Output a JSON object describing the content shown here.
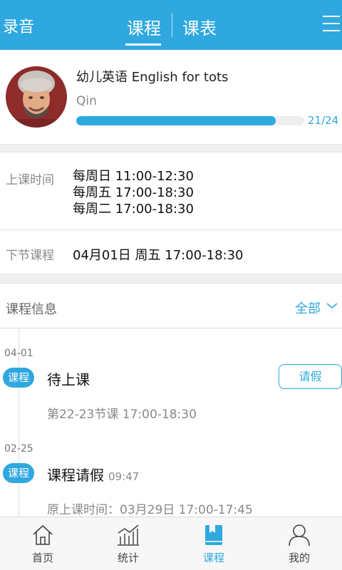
{
  "colors": {
    "accent": "#2fa8e0",
    "muted": "#888888",
    "divider": "#e4e4e4"
  },
  "header": {
    "left_label": "录音",
    "tabs": [
      {
        "label": "课程",
        "active": true
      },
      {
        "label": "课表",
        "active": false
      }
    ],
    "menu_icon": "hamburger-menu-icon"
  },
  "profile": {
    "course_title": "幼儿英语 English for tots",
    "teacher": "Qin",
    "progress_text": "21/24",
    "progress_fraction": 0.875
  },
  "schedule": {
    "class_time_label": "上课时间",
    "class_times": [
      "每周日 11:00-12:30",
      "每周五 17:00-18:30",
      "每周二 17:00-18:30"
    ],
    "next_label": "下节课程",
    "next_value": "04月01日 周五 17:00-18:30"
  },
  "info": {
    "title": "课程信息",
    "filter": "全部",
    "filter_icon": "chevron-down-icon"
  },
  "timeline": [
    {
      "date": "04-01",
      "tag": "课程",
      "title": "待上课",
      "time": "",
      "detail": "第22-23节课 17:00-18:30",
      "action": "请假"
    },
    {
      "date": "02-25",
      "tag": "课程",
      "title": "课程请假",
      "time": "09:47",
      "detail": "原上课时间：03月29日 17:00-17:45"
    }
  ],
  "tabbar": {
    "items": [
      {
        "label": "首页",
        "icon": "home-icon",
        "active": false
      },
      {
        "label": "统计",
        "icon": "stats-icon",
        "active": false
      },
      {
        "label": "课程",
        "icon": "book-icon",
        "active": true
      },
      {
        "label": "我的",
        "icon": "user-icon",
        "active": false
      }
    ]
  }
}
